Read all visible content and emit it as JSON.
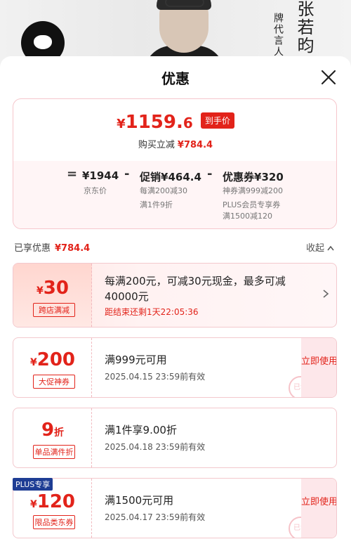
{
  "banner": {
    "endorser_role": "牌代言人",
    "endorser_name": "张若昀"
  },
  "sheet": {
    "title": "优惠"
  },
  "summary": {
    "price_symbol": "¥",
    "price_int": "1159.",
    "price_dec": "6",
    "price_tag": "到手价",
    "save_label": "购买立减",
    "save_value": "¥784.4",
    "formula": {
      "eq": "=",
      "base_value": "¥1944",
      "base_label": "京东价",
      "minus1": "-",
      "promo_label": "促销",
      "promo_value": "¥464.4",
      "promo_line1": "每满200减30",
      "promo_line2": "满1件9折",
      "minus2": "-",
      "coupon_label": "优惠券",
      "coupon_value": "¥320",
      "coupon_line1": "神券满999减200",
      "coupon_line2": "PLUS会员专享券",
      "coupon_line3": "满1500减120"
    }
  },
  "enjoyed": {
    "label": "已享优惠",
    "value": "¥784.4",
    "collapse_label": "收起"
  },
  "coupons": [
    {
      "symbol": "¥",
      "value": "30",
      "tag": "跨店满减",
      "desc": "每满200元，可减30元现金，最多可减",
      "desc2": "40000元",
      "countdown": "距结束还剩1天22:05:36"
    },
    {
      "symbol": "¥",
      "value": "200",
      "tag": "大促神券",
      "desc": "满999元可用",
      "expiry": "2025.04.15  23:59前有效",
      "action": "立即使用",
      "stamp": "已领"
    },
    {
      "value": "9",
      "unit": "折",
      "tag": "单品满件折",
      "desc": "满1件享9.00折",
      "expiry": "2025.04.18  23:59前有效"
    },
    {
      "badge": "PLUS专享",
      "symbol": "¥",
      "value": "120",
      "tag": "限品类东券",
      "desc": "满1500元可用",
      "expiry": "2025.04.17  23:59前有效",
      "action": "立即使用",
      "stamp": "已领"
    }
  ],
  "colors": {
    "accent": "#e2231a",
    "plus_badge": "#1e3d94"
  }
}
